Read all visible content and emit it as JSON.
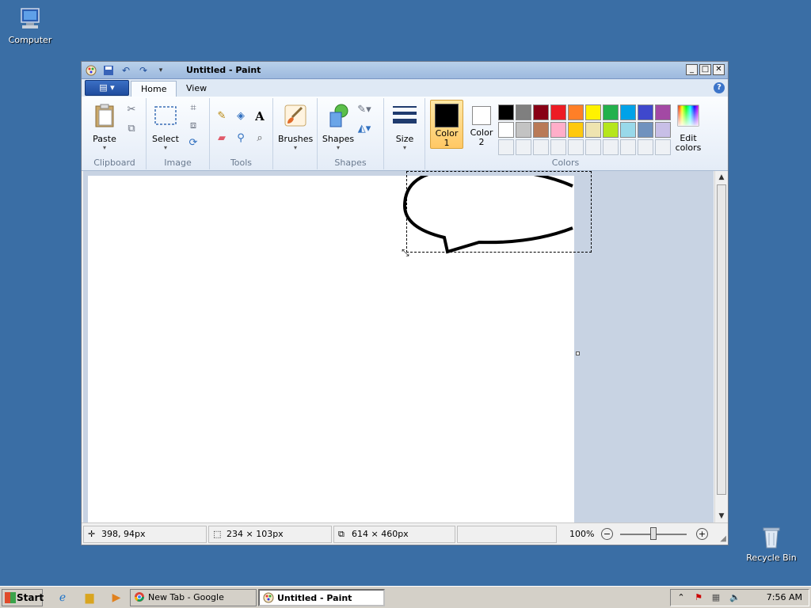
{
  "desktop": {
    "computer_label": "Computer",
    "recycle_label": "Recycle Bin"
  },
  "window": {
    "title": "Untitled - Paint",
    "controls": {
      "minimize": "_",
      "maximize": "□",
      "close": "✕"
    }
  },
  "ribbon": {
    "tabs": [
      {
        "label": "Home"
      },
      {
        "label": "View"
      }
    ],
    "help": "?",
    "groups": {
      "clipboard": {
        "label": "Clipboard",
        "paste": "Paste"
      },
      "image": {
        "label": "Image",
        "select": "Select"
      },
      "tools": {
        "label": "Tools",
        "text_tool": "A"
      },
      "shapes": {
        "label": "Shapes",
        "brushes": "Brushes",
        "shapes": "Shapes"
      },
      "size": {
        "label": "Size"
      },
      "colors": {
        "label": "Colors",
        "color1": "Color\n1",
        "color2": "Color\n2",
        "edit_colors": "Edit\ncolors",
        "color1_value": "#000000",
        "color2_value": "#ffffff",
        "palette": [
          "#000000",
          "#7f7f7f",
          "#880015",
          "#ed1c24",
          "#ff7f27",
          "#fff200",
          "#22b14c",
          "#00a2e8",
          "#3f48cc",
          "#a349a4",
          "#ffffff",
          "#c3c3c3",
          "#b97a57",
          "#ffaec9",
          "#ffc90e",
          "#efe4b0",
          "#b5e61d",
          "#99d9ea",
          "#7092be",
          "#c8bfe7"
        ]
      }
    }
  },
  "status": {
    "cursor_pos": "398, 94px",
    "selection_size": "234 × 103px",
    "canvas_size": "614 × 460px",
    "zoom": "100%"
  },
  "taskbar": {
    "start": "Start",
    "tasks": [
      {
        "label": "New Tab - Google Chrome"
      },
      {
        "label": "Untitled - Paint"
      }
    ],
    "time": "7:56 AM"
  }
}
